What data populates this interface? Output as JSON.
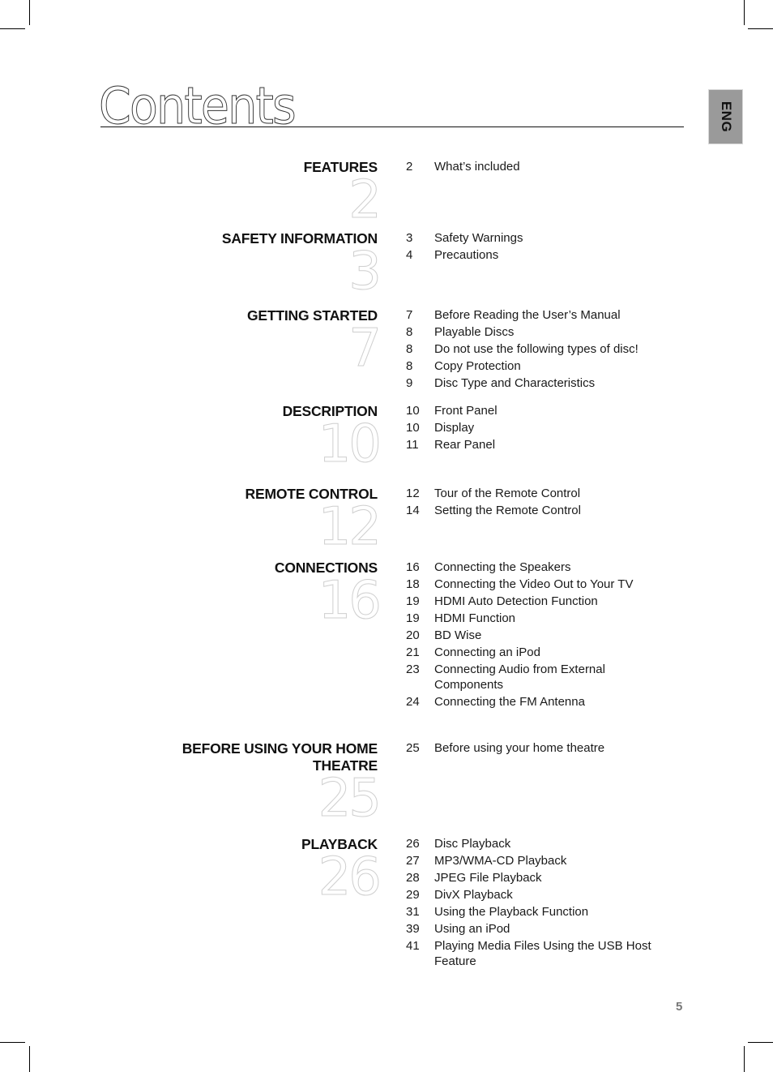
{
  "page": {
    "title": "Contents",
    "language_tab": "ENG",
    "page_number": "5"
  },
  "sections": [
    {
      "heading": "FEATURES",
      "start_page": "2",
      "items": [
        {
          "page": "2",
          "label": "What’s included"
        }
      ]
    },
    {
      "heading": "SAFETY INFORMATION",
      "start_page": "3",
      "items": [
        {
          "page": "3",
          "label": "Safety Warnings"
        },
        {
          "page": "4",
          "label": "Precautions"
        }
      ]
    },
    {
      "heading": "GETTING STARTED",
      "start_page": "7",
      "items": [
        {
          "page": "7",
          "label": "Before Reading the User’s Manual"
        },
        {
          "page": "8",
          "label": "Playable Discs"
        },
        {
          "page": "8",
          "label": "Do not use the following types of disc!"
        },
        {
          "page": "8",
          "label": "Copy Protection"
        },
        {
          "page": "9",
          "label": "Disc Type and Characteristics"
        }
      ]
    },
    {
      "heading": "DESCRIPTION",
      "start_page": "10",
      "items": [
        {
          "page": "10",
          "label": "Front Panel"
        },
        {
          "page": "10",
          "label": "Display"
        },
        {
          "page": "11",
          "label": "Rear Panel"
        }
      ]
    },
    {
      "heading": "REMOTE CONTROL",
      "start_page": "12",
      "items": [
        {
          "page": "12",
          "label": "Tour of the Remote Control"
        },
        {
          "page": "14",
          "label": "Setting the Remote Control"
        }
      ]
    },
    {
      "heading": "CONNECTIONS",
      "start_page": "16",
      "items": [
        {
          "page": "16",
          "label": "Connecting the Speakers"
        },
        {
          "page": "18",
          "label": "Connecting the Video Out to Your TV"
        },
        {
          "page": "19",
          "label": "HDMI Auto Detection Function"
        },
        {
          "page": "19",
          "label": "HDMI Function"
        },
        {
          "page": "20",
          "label": "BD Wise"
        },
        {
          "page": "21",
          "label": "Connecting an iPod"
        },
        {
          "page": "23",
          "label": "Connecting Audio from External Components"
        },
        {
          "page": "24",
          "label": "Connecting the FM Antenna"
        }
      ]
    },
    {
      "heading": "BEFORE USING YOUR HOME THEATRE",
      "start_page": "25",
      "items": [
        {
          "page": "25",
          "label": "Before using your home theatre"
        }
      ]
    },
    {
      "heading": "PLAYBACK",
      "start_page": "26",
      "items": [
        {
          "page": "26",
          "label": "Disc Playback"
        },
        {
          "page": "27",
          "label": "MP3/WMA-CD Playback"
        },
        {
          "page": "28",
          "label": "JPEG File Playback"
        },
        {
          "page": "29",
          "label": "DivX Playback"
        },
        {
          "page": "31",
          "label": "Using the Playback Function"
        },
        {
          "page": "39",
          "label": "Using an iPod"
        },
        {
          "page": "41",
          "label": "Playing Media Files Using the USB Host Feature"
        }
      ]
    }
  ]
}
